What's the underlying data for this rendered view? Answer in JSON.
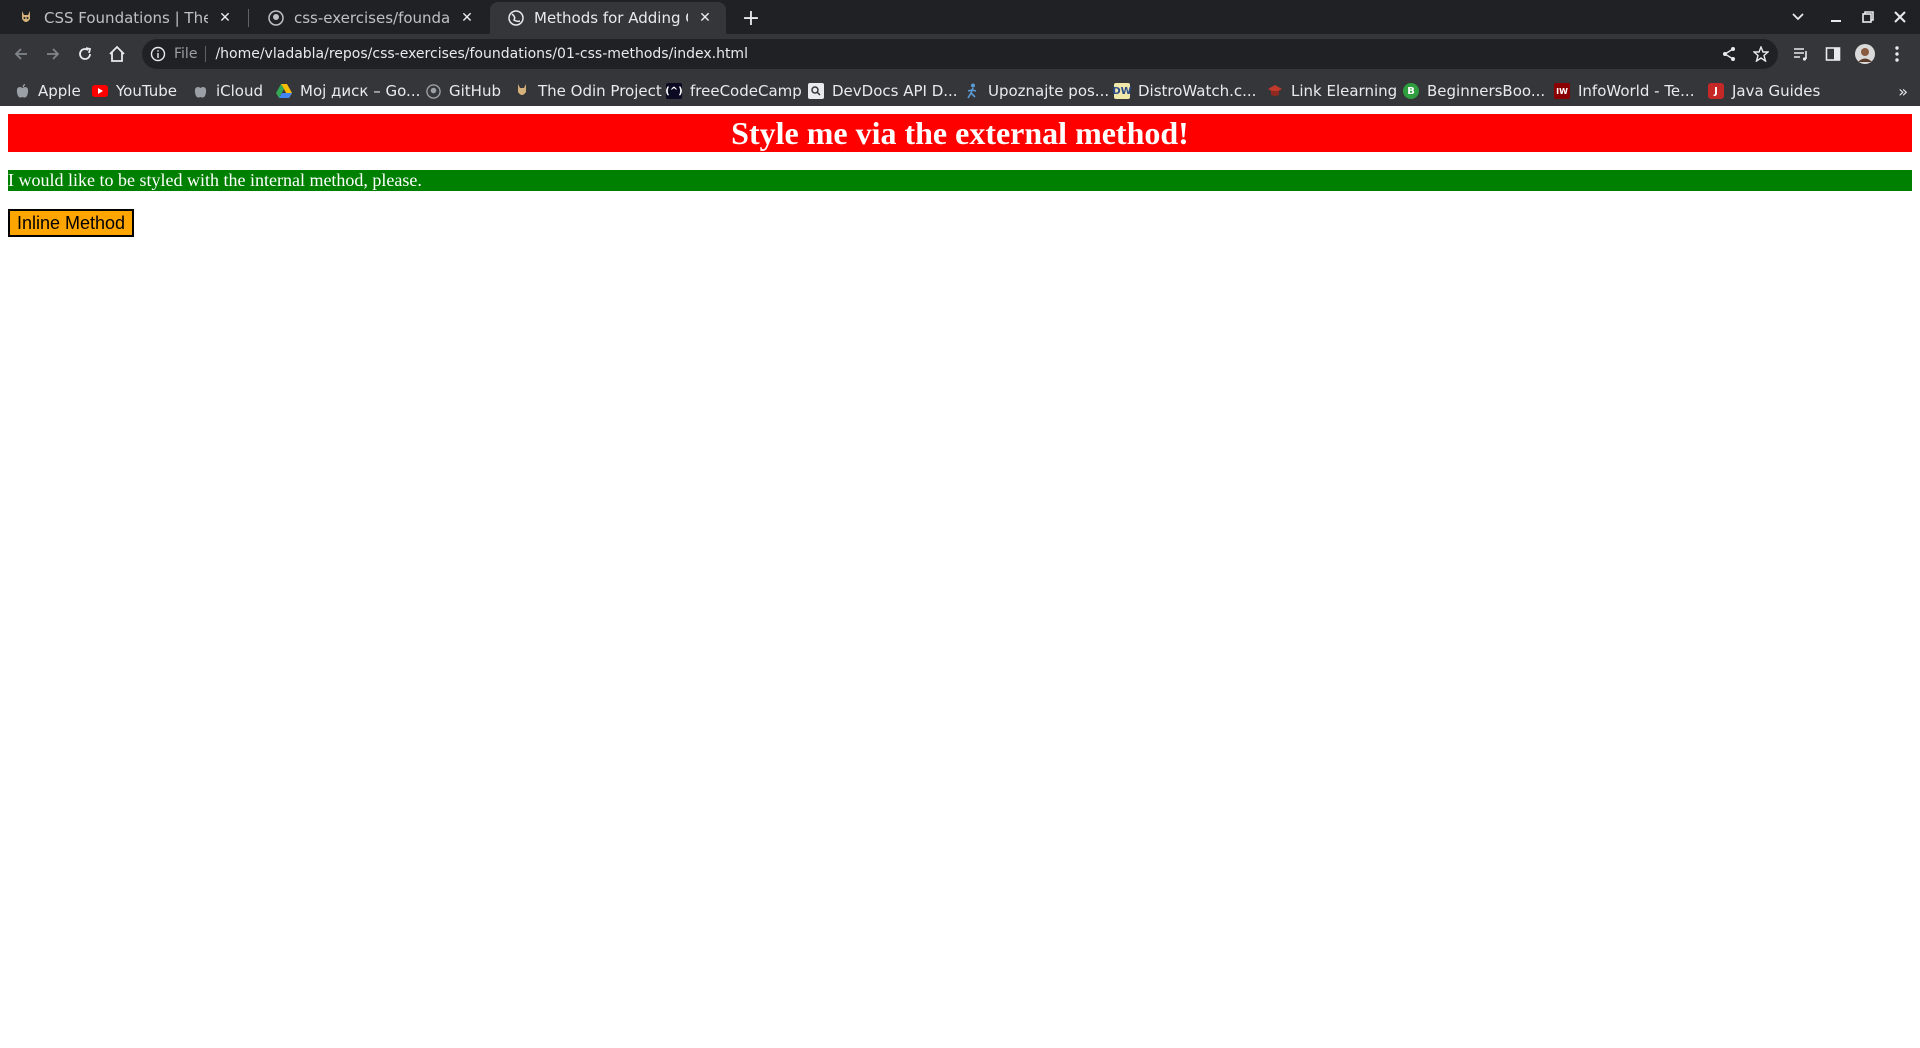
{
  "browser": {
    "tabs": [
      {
        "title": "CSS Foundations | The Od",
        "icon": "odin-icon"
      },
      {
        "title": "css-exercises/foundations",
        "icon": "github-icon"
      },
      {
        "title": "Methods for Adding CSS",
        "icon": "globe-icon"
      }
    ],
    "new_tab_label": "+",
    "address": {
      "scheme": "File",
      "url": "/home/vladabla/repos/css-exercises/foundations/01-css-methods/index.html"
    },
    "bookmarks": [
      {
        "label": "Apple",
        "icon": "apple-icon"
      },
      {
        "label": "YouTube",
        "icon": "youtube-icon"
      },
      {
        "label": "iCloud",
        "icon": "apple-icon"
      },
      {
        "label": "Мој диск – Go...",
        "icon": "google-drive-icon"
      },
      {
        "label": "GitHub",
        "icon": "github-icon"
      },
      {
        "label": "The Odin Project",
        "icon": "odin-icon"
      },
      {
        "label": "freeCodeCamp",
        "icon": "freecodecamp-icon"
      },
      {
        "label": "DevDocs API D...",
        "icon": "devdocs-icon"
      },
      {
        "label": "Upoznajte pos...",
        "icon": "runner-icon"
      },
      {
        "label": "DistroWatch.c...",
        "icon": "distrowatch-icon"
      },
      {
        "label": "Link Elearning",
        "icon": "elearning-icon"
      },
      {
        "label": "BeginnersBoo...",
        "icon": "beginnersbook-icon"
      },
      {
        "label": "InfoWorld - Te...",
        "icon": "infoworld-icon"
      },
      {
        "label": "Java Guides",
        "icon": "javaguides-icon"
      }
    ]
  },
  "page": {
    "heading": "Style me via the external method!",
    "paragraph": "I would like to be styled with the internal method, please.",
    "button_label": "Inline Method"
  },
  "colors": {
    "heading_bg": "#ff0000",
    "paragraph_bg": "#008000",
    "button_bg": "#ffa500"
  }
}
